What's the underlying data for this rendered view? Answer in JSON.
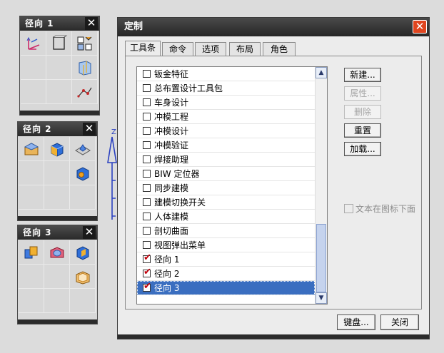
{
  "toolbars": [
    {
      "title": "径向 1",
      "rows": 3
    },
    {
      "title": "径向 2",
      "rows": 3
    },
    {
      "title": "径向 3",
      "rows": 3
    }
  ],
  "axis_label": "Z",
  "dialog": {
    "title": "定制",
    "tabs": [
      "工具条",
      "命令",
      "选项",
      "布局",
      "角色"
    ],
    "active_tab": "工具条",
    "list_items": [
      {
        "label": "钣金特征",
        "checked": false,
        "selected": false
      },
      {
        "label": "总布置设计工具包",
        "checked": false,
        "selected": false
      },
      {
        "label": "车身设计",
        "checked": false,
        "selected": false
      },
      {
        "label": "冲模工程",
        "checked": false,
        "selected": false
      },
      {
        "label": "冲模设计",
        "checked": false,
        "selected": false
      },
      {
        "label": "冲模验证",
        "checked": false,
        "selected": false
      },
      {
        "label": "焊接助理",
        "checked": false,
        "selected": false
      },
      {
        "label": "BIW 定位器",
        "checked": false,
        "selected": false
      },
      {
        "label": "同步建模",
        "checked": false,
        "selected": false
      },
      {
        "label": "建模切换开关",
        "checked": false,
        "selected": false
      },
      {
        "label": "人体建模",
        "checked": false,
        "selected": false
      },
      {
        "label": "剖切曲面",
        "checked": false,
        "selected": false
      },
      {
        "label": "视图弹出菜单",
        "checked": false,
        "selected": false
      },
      {
        "label": "径向 1",
        "checked": true,
        "selected": false
      },
      {
        "label": "径向 2",
        "checked": true,
        "selected": false
      },
      {
        "label": "径向 3",
        "checked": true,
        "selected": true
      }
    ],
    "buttons": {
      "new": "新建...",
      "properties": "属性...",
      "delete": "删除",
      "reset": "重置",
      "load": "加载..."
    },
    "text_below_icon": "文本在图标下面",
    "keyboard": "键盘...",
    "close": "关闭"
  },
  "colors": {
    "selection": "#3a6ec0",
    "check": "#c0000b",
    "close_button": "#e0451f"
  }
}
